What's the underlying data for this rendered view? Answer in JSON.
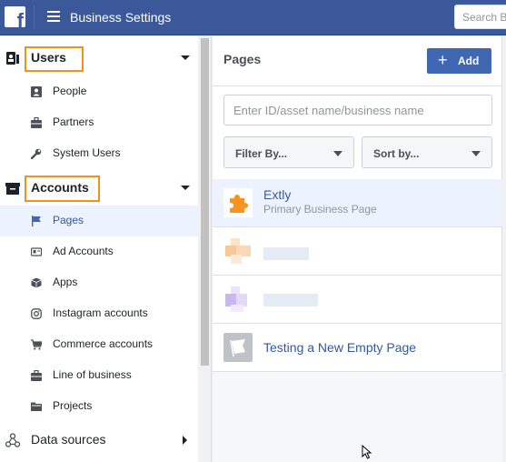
{
  "topbar": {
    "logo_letter": "f",
    "title": "Business Settings",
    "search_placeholder": "Search B"
  },
  "sidebar": {
    "users": {
      "label": "Users",
      "items": [
        {
          "label": "People",
          "icon": "person-card-icon"
        },
        {
          "label": "Partners",
          "icon": "briefcase-icon"
        },
        {
          "label": "System Users",
          "icon": "wrench-icon"
        }
      ]
    },
    "accounts": {
      "label": "Accounts",
      "items": [
        {
          "label": "Pages",
          "icon": "flag-icon",
          "active": true
        },
        {
          "label": "Ad Accounts",
          "icon": "ad-card-icon"
        },
        {
          "label": "Apps",
          "icon": "cube-icon"
        },
        {
          "label": "Instagram accounts",
          "icon": "instagram-icon"
        },
        {
          "label": "Commerce accounts",
          "icon": "cart-icon"
        },
        {
          "label": "Line of business",
          "icon": "briefcase-icon"
        },
        {
          "label": "Projects",
          "icon": "folder-icon"
        }
      ]
    },
    "data_sources": {
      "label": "Data sources"
    }
  },
  "main": {
    "title": "Pages",
    "add_label": "Add",
    "filter_placeholder": "Enter ID/asset name/business name",
    "filter_by_label": "Filter By...",
    "sort_by_label": "Sort by...",
    "pages": [
      {
        "name": "Extly",
        "subtitle": "Primary Business Page",
        "selected": true,
        "thumb_color": "#f7931e"
      },
      {
        "name": "",
        "subtitle": "",
        "blurred": true,
        "thumb_color": "#f8c08a"
      },
      {
        "name": "",
        "subtitle": "",
        "blurred": true,
        "thumb_color": "#c9b8f0"
      },
      {
        "name": "Testing a New Empty Page",
        "subtitle": "",
        "thumb_color": "#bec3c9"
      }
    ]
  },
  "colors": {
    "topbar": "#3b5998",
    "accent_button": "#4267b2",
    "highlight_box": "#f0921e",
    "link": "#365899",
    "selected_bg": "#ecf3fe"
  }
}
